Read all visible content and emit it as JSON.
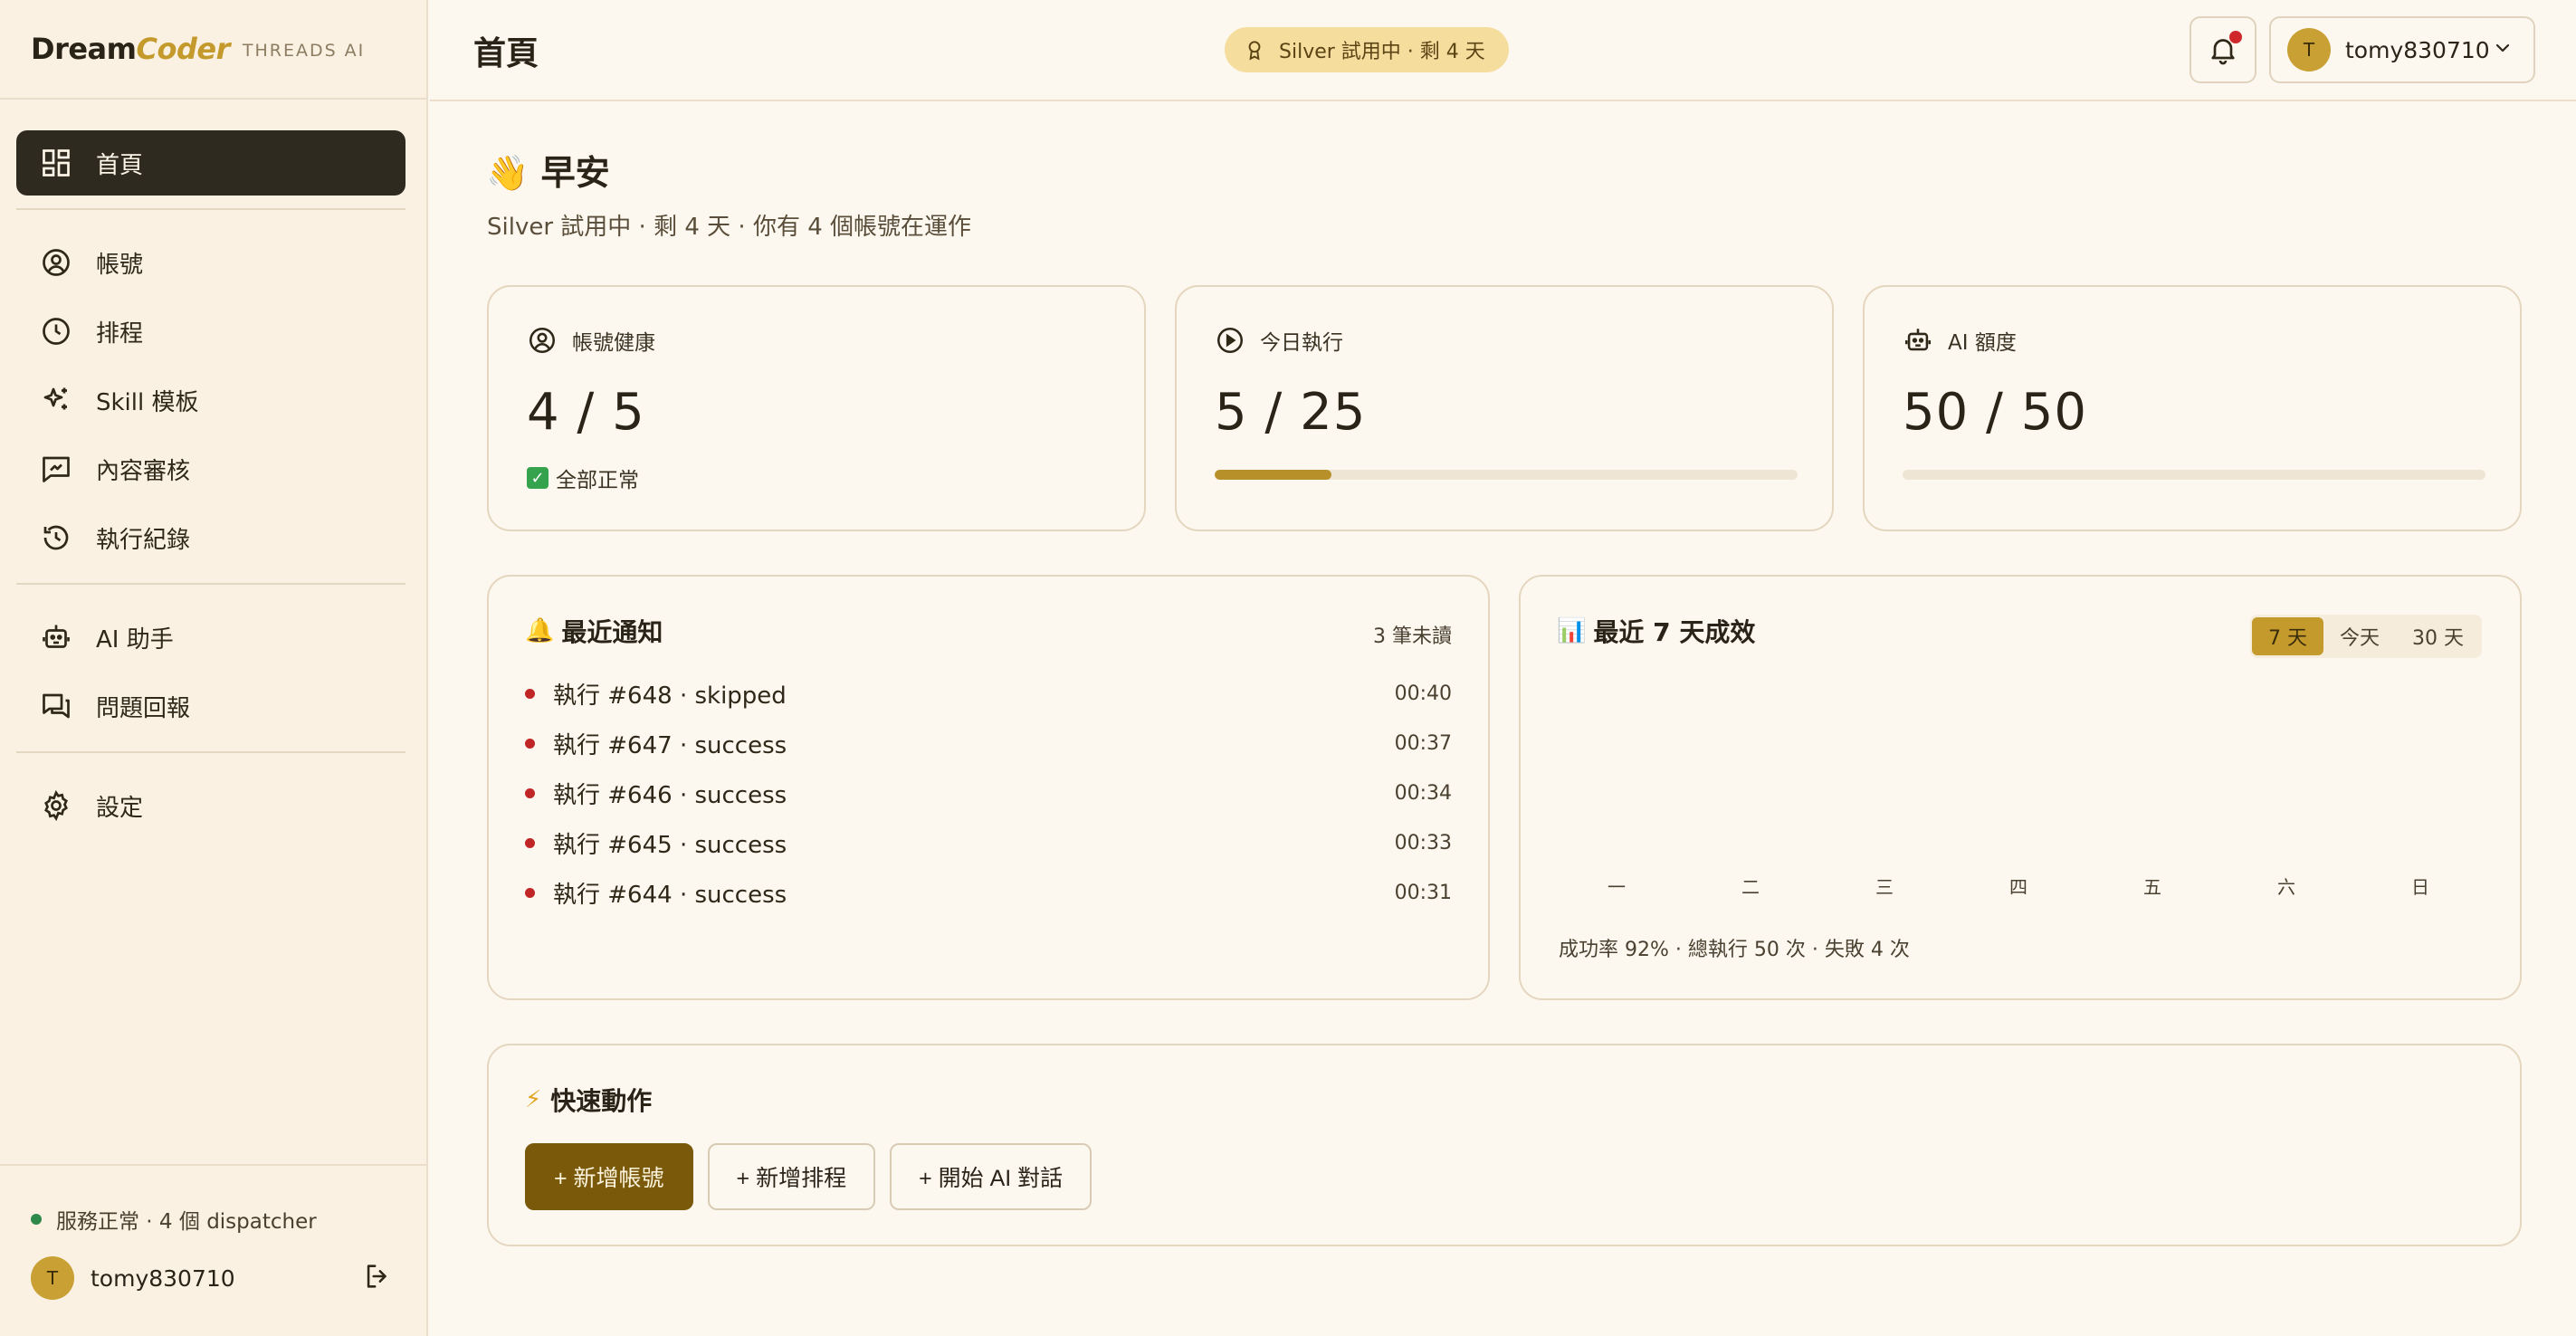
{
  "brand": {
    "part1": "Dream",
    "part2": "Coder",
    "sub": "THREADS AI"
  },
  "sidebar": {
    "items": [
      {
        "label": "首頁",
        "icon": "dashboard-icon"
      },
      {
        "label": "帳號",
        "icon": "user-circle-icon"
      },
      {
        "label": "排程",
        "icon": "clock-icon"
      },
      {
        "label": "Skill 模板",
        "icon": "sparkles-icon"
      },
      {
        "label": "內容審核",
        "icon": "review-icon"
      },
      {
        "label": "執行紀錄",
        "icon": "history-icon"
      },
      {
        "label": "AI 助手",
        "icon": "robot-icon"
      },
      {
        "label": "問題回報",
        "icon": "feedback-icon"
      },
      {
        "label": "設定",
        "icon": "gear-icon"
      }
    ],
    "status": "服務正常 · 4 個 dispatcher",
    "user": {
      "initial": "T",
      "name": "tomy830710"
    }
  },
  "header": {
    "title": "首頁",
    "trial": "Silver 試用中 · 剩 4 天",
    "user": {
      "initial": "T",
      "name": "tomy830710"
    }
  },
  "greeting": {
    "emoji": "👋",
    "title": "早安",
    "subtitle": "Silver 試用中 · 剩 4 天 · 你有 4 個帳號在運作"
  },
  "stats": {
    "health": {
      "label": "帳號健康",
      "value": "4 / 5",
      "note": "全部正常"
    },
    "today": {
      "label": "今日執行",
      "value": "5 / 25",
      "progress": 0.2
    },
    "ai": {
      "label": "AI 額度",
      "value": "50 / 50",
      "progress": 0.0
    }
  },
  "notifications": {
    "title": "最近通知",
    "unread": "3 筆未讀",
    "items": [
      {
        "text": "執行 #648 · skipped",
        "time": "00:40"
      },
      {
        "text": "執行 #647 · success",
        "time": "00:37"
      },
      {
        "text": "執行 #646 · success",
        "time": "00:34"
      },
      {
        "text": "執行 #645 · success",
        "time": "00:33"
      },
      {
        "text": "執行 #644 · success",
        "time": "00:31"
      }
    ]
  },
  "performance": {
    "title": "最近 7 天成效",
    "ranges": [
      "7 天",
      "今天",
      "30 天"
    ],
    "active_range": "7 天",
    "summary": "成功率 92% · 總執行 50 次 · 失敗 4 次"
  },
  "chart_data": {
    "type": "bar",
    "categories": [
      "一",
      "二",
      "三",
      "四",
      "五",
      "六",
      "日"
    ],
    "values": [
      0,
      0,
      0,
      0,
      0,
      0,
      0
    ],
    "title": "最近 7 天成效",
    "xlabel": "",
    "ylabel": "",
    "grid": false
  },
  "quick": {
    "title": "快速動作",
    "buttons": [
      "+ 新增帳號",
      "+ 新增排程",
      "+ 開始 AI 對話"
    ]
  },
  "colors": {
    "accent": "#c49a2c",
    "primary_button": "#7a5a0a",
    "sidebar_active": "#2e2a20",
    "alert_dot": "#c02626",
    "status_ok": "#2e8a4a"
  }
}
